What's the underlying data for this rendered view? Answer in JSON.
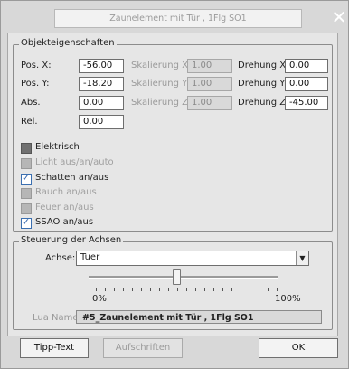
{
  "window": {
    "title": "Zaunelement mit Tür , 1Flg SO1",
    "close_glyph": "✕"
  },
  "objekt": {
    "group_title": "Objekteigenschaften",
    "pos_x": {
      "label": "Pos. X:",
      "value": "-56.00"
    },
    "pos_y": {
      "label": "Pos. Y:",
      "value": "-18.20"
    },
    "abs": {
      "label": "Abs.",
      "value": "0.00"
    },
    "rel": {
      "label": "Rel.",
      "value": "0.00"
    },
    "skal_x": {
      "label": "Skalierung X:",
      "value": "1.00"
    },
    "skal_y": {
      "label": "Skalierung Y:",
      "value": "1.00"
    },
    "skal_z": {
      "label": "Skalierung Z:",
      "value": "1.00"
    },
    "dreh_x": {
      "label": "Drehung X:",
      "value": "0.00"
    },
    "dreh_y": {
      "label": "Drehung Y:",
      "value": "0.00"
    },
    "dreh_z": {
      "label": "Drehung Z:",
      "value": "-45.00"
    },
    "checkboxes": [
      {
        "label": "Elektrisch",
        "checked": false,
        "disabled": false
      },
      {
        "label": "Licht aus/an/auto",
        "checked": false,
        "disabled": true
      },
      {
        "label": "Schatten an/aus",
        "checked": true,
        "disabled": false
      },
      {
        "label": "Rauch an/aus",
        "checked": false,
        "disabled": true
      },
      {
        "label": "Feuer an/aus",
        "checked": false,
        "disabled": true
      },
      {
        "label": "SSAO an/aus",
        "checked": true,
        "disabled": false
      }
    ]
  },
  "steuerung": {
    "group_title": "Steuerung der Achsen",
    "achse_label": "Achse:",
    "achse_value": "Tuer",
    "dropdown_glyph": "▼",
    "slider_min_label": "0%",
    "slider_max_label": "100%",
    "slider_fraction": 0.46,
    "lua_label": "Lua Name:",
    "lua_value": "#5_Zaunelement mit Tür , 1Flg SO1"
  },
  "buttons": {
    "tipp": "Tipp-Text",
    "aufschriften": "Aufschriften",
    "ok": "OK"
  }
}
